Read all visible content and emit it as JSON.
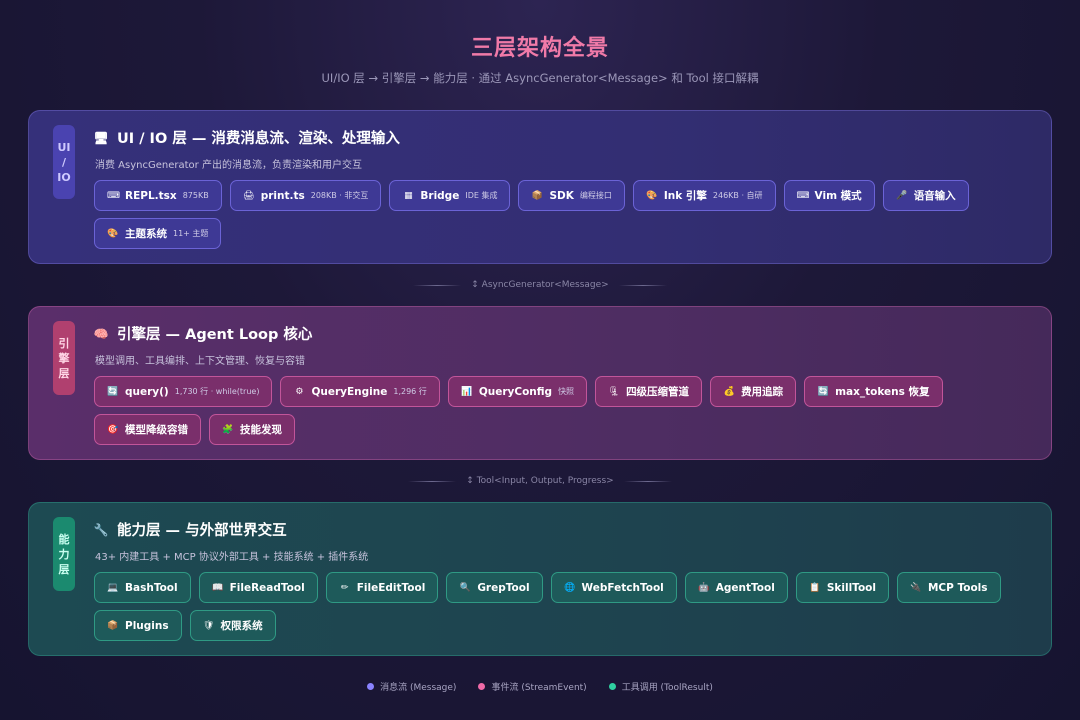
{
  "header": {
    "title": "三层架构全景",
    "subtitle": "UI/IO 层 → 引擎层 → 能力层 · 通过 AsyncGenerator<Message> 和 Tool 接口解耦"
  },
  "layers": {
    "ui": {
      "tag": [
        "UI",
        "/",
        "IO"
      ],
      "icon": "🖥",
      "title": "UI / IO 层 — 消费消息流、渲染、处理输入",
      "desc": "消费 AsyncGenerator 产出的消息流，负责渲染和用户交互",
      "chips": [
        {
          "icon": "⌨",
          "label": "REPL.tsx",
          "note": "875KB"
        },
        {
          "icon": "🖨",
          "label": "print.ts",
          "note": "208KB · 非交互"
        },
        {
          "icon": "▦",
          "label": "Bridge",
          "note": "IDE 集成"
        },
        {
          "icon": "📦",
          "label": "SDK",
          "note": "编程接口"
        },
        {
          "icon": "🎨",
          "label": "Ink 引擎",
          "note": "246KB · 自研"
        },
        {
          "icon": "⌨",
          "label": "Vim 模式",
          "note": ""
        },
        {
          "icon": "🎤",
          "label": "语音输入",
          "note": ""
        },
        {
          "icon": "🎨",
          "label": "主题系统",
          "note": "11+ 主题"
        }
      ]
    },
    "engine": {
      "tag": [
        "引",
        "擎",
        "层"
      ],
      "icon": "🧠",
      "title": "引擎层 — Agent Loop 核心",
      "desc": "模型调用、工具编排、上下文管理、恢复与容错",
      "chips": [
        {
          "icon": "🔄",
          "label": "query()",
          "note": "1,730 行 · while(true)"
        },
        {
          "icon": "⚙",
          "label": "QueryEngine",
          "note": "1,296 行"
        },
        {
          "icon": "📊",
          "label": "QueryConfig",
          "note": "快照"
        },
        {
          "icon": "🗜",
          "label": "四级压缩管道",
          "note": ""
        },
        {
          "icon": "💰",
          "label": "费用追踪",
          "note": ""
        },
        {
          "icon": "🔄",
          "label": "max_tokens 恢复",
          "note": ""
        },
        {
          "icon": "🎯",
          "label": "模型降级容错",
          "note": ""
        },
        {
          "icon": "🧩",
          "label": "技能发现",
          "note": ""
        }
      ]
    },
    "cap": {
      "tag": [
        "能",
        "力",
        "层"
      ],
      "icon": "🔧",
      "title": "能力层 — 与外部世界交互",
      "desc": "43+ 内建工具 + MCP 协议外部工具 + 技能系统 + 插件系统",
      "chips": [
        {
          "icon": "💻",
          "label": "BashTool",
          "note": ""
        },
        {
          "icon": "📖",
          "label": "FileReadTool",
          "note": ""
        },
        {
          "icon": "✏",
          "label": "FileEditTool",
          "note": ""
        },
        {
          "icon": "🔍",
          "label": "GrepTool",
          "note": ""
        },
        {
          "icon": "🌐",
          "label": "WebFetchTool",
          "note": ""
        },
        {
          "icon": "🤖",
          "label": "AgentTool",
          "note": ""
        },
        {
          "icon": "📋",
          "label": "SkillTool",
          "note": ""
        },
        {
          "icon": "🔌",
          "label": "MCP Tools",
          "note": ""
        },
        {
          "icon": "📦",
          "label": "Plugins",
          "note": ""
        },
        {
          "icon": "🛡",
          "label": "权限系统",
          "note": ""
        }
      ]
    }
  },
  "connectors": {
    "ui_engine": "↕ AsyncGenerator<Message>",
    "engine_cap": "↕ Tool<Input, Output, Progress>"
  },
  "legend": [
    {
      "label": "消息流 (Message)",
      "color": "#8a83ff"
    },
    {
      "label": "事件流 (StreamEvent)",
      "color": "#f06aa8"
    },
    {
      "label": "工具调用 (ToolResult)",
      "color": "#2fd0a0"
    }
  ]
}
